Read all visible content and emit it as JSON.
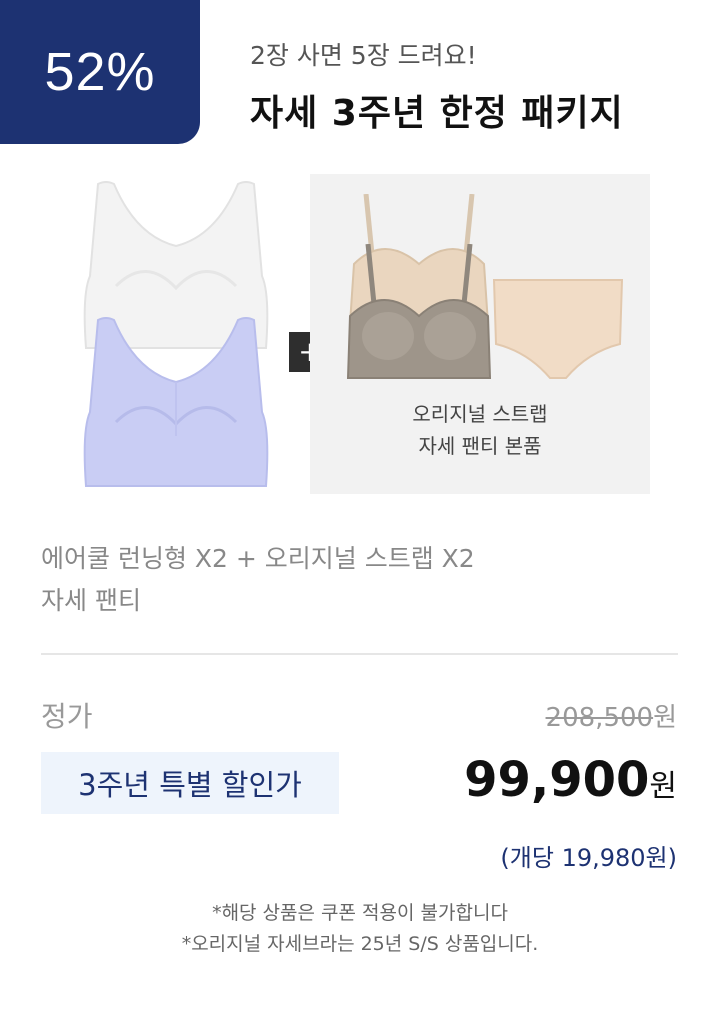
{
  "badge": {
    "discount": "52%"
  },
  "header": {
    "subtitle": "2장 사면 5장 드려요!",
    "title": "자세 3주년 한정 패키지"
  },
  "products": {
    "plus_symbol": "+",
    "bonus_caption_line1": "오리지널 스트랩",
    "bonus_caption_line2": "자세 팬티 본품"
  },
  "description": {
    "line1": "에어쿨 런닝형 X2 + 오리지널 스트랩 X2",
    "line2": "자세 팬티"
  },
  "pricing": {
    "regular_label": "정가",
    "regular_price": "208,500",
    "regular_unit": "원",
    "special_label": "3주년 특별 할인가",
    "sale_price": "99,900",
    "sale_unit": "원",
    "per_unit": "(개당 19,980원)"
  },
  "notes": {
    "line1": "*해당 상품은 쿠폰 적용이 불가합니다",
    "line2": "*오리지널 자세브라는 25년 S/S 상품입니다."
  },
  "colors": {
    "brand_navy": "#1d3272",
    "tag_background": "#eef4fc",
    "bra_white": "#f3f3f3",
    "bra_lavender": "#c9cdf4",
    "bra_beige": "#ead6bf",
    "bra_gray": "#9e958a",
    "panty_beige": "#f1dcc6"
  }
}
